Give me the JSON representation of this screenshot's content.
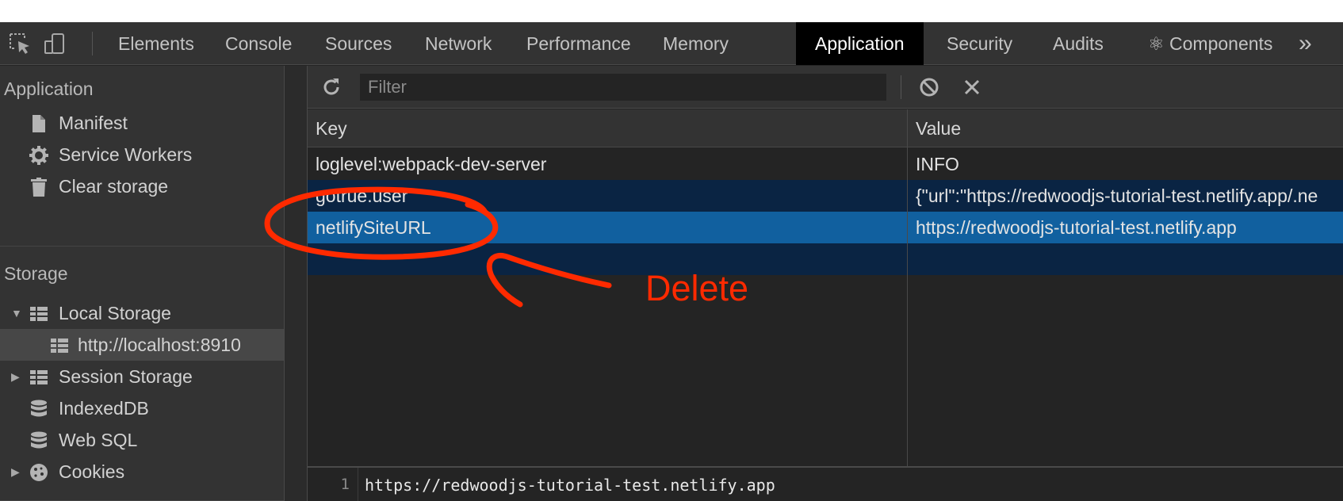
{
  "tabs": [
    {
      "label": "Elements"
    },
    {
      "label": "Console"
    },
    {
      "label": "Sources"
    },
    {
      "label": "Network"
    },
    {
      "label": "Performance"
    },
    {
      "label": "Memory"
    },
    {
      "label": "Application",
      "active": true
    },
    {
      "label": "Security"
    },
    {
      "label": "Audits"
    },
    {
      "label": "⚛ Components"
    }
  ],
  "tab_more": "»",
  "sidebar": {
    "application_title": "Application",
    "application_items": [
      {
        "label": "Manifest",
        "icon": "document-icon"
      },
      {
        "label": "Service Workers",
        "icon": "gear-icon"
      },
      {
        "label": "Clear storage",
        "icon": "trash-icon"
      }
    ],
    "storage_title": "Storage",
    "storage_items": [
      {
        "label": "Local Storage",
        "icon": "grid-icon",
        "expanded": true
      },
      {
        "label": "http://localhost:8910",
        "icon": "grid-icon",
        "selected": true
      },
      {
        "label": "Session Storage",
        "icon": "grid-icon",
        "expanded": false
      },
      {
        "label": "IndexedDB",
        "icon": "database-icon"
      },
      {
        "label": "Web SQL",
        "icon": "database-icon"
      },
      {
        "label": "Cookies",
        "icon": "cookie-icon",
        "expanded": false
      }
    ]
  },
  "toolbar": {
    "filter_placeholder": "Filter",
    "filter_value": ""
  },
  "table": {
    "columns": [
      "Key",
      "Value"
    ],
    "rows": [
      {
        "key": "loglevel:webpack-dev-server",
        "value": "INFO"
      },
      {
        "key": "gotrue.user",
        "value": "{\"url\":\"https://redwoodjs-tutorial-test.netlify.app/.ne"
      },
      {
        "key": "netlifySiteURL",
        "value": "https://redwoodjs-tutorial-test.netlify.app"
      },
      {
        "key": "",
        "value": ""
      }
    ]
  },
  "preview": {
    "line_number": "1",
    "text": "https://redwoodjs-tutorial-test.netlify.app"
  },
  "annotation": {
    "label": "Delete",
    "color": "#ff2a00"
  },
  "colors": {
    "selected_row": "#11609f",
    "dim_row": "#0a2443",
    "active_tab": "#000000"
  }
}
